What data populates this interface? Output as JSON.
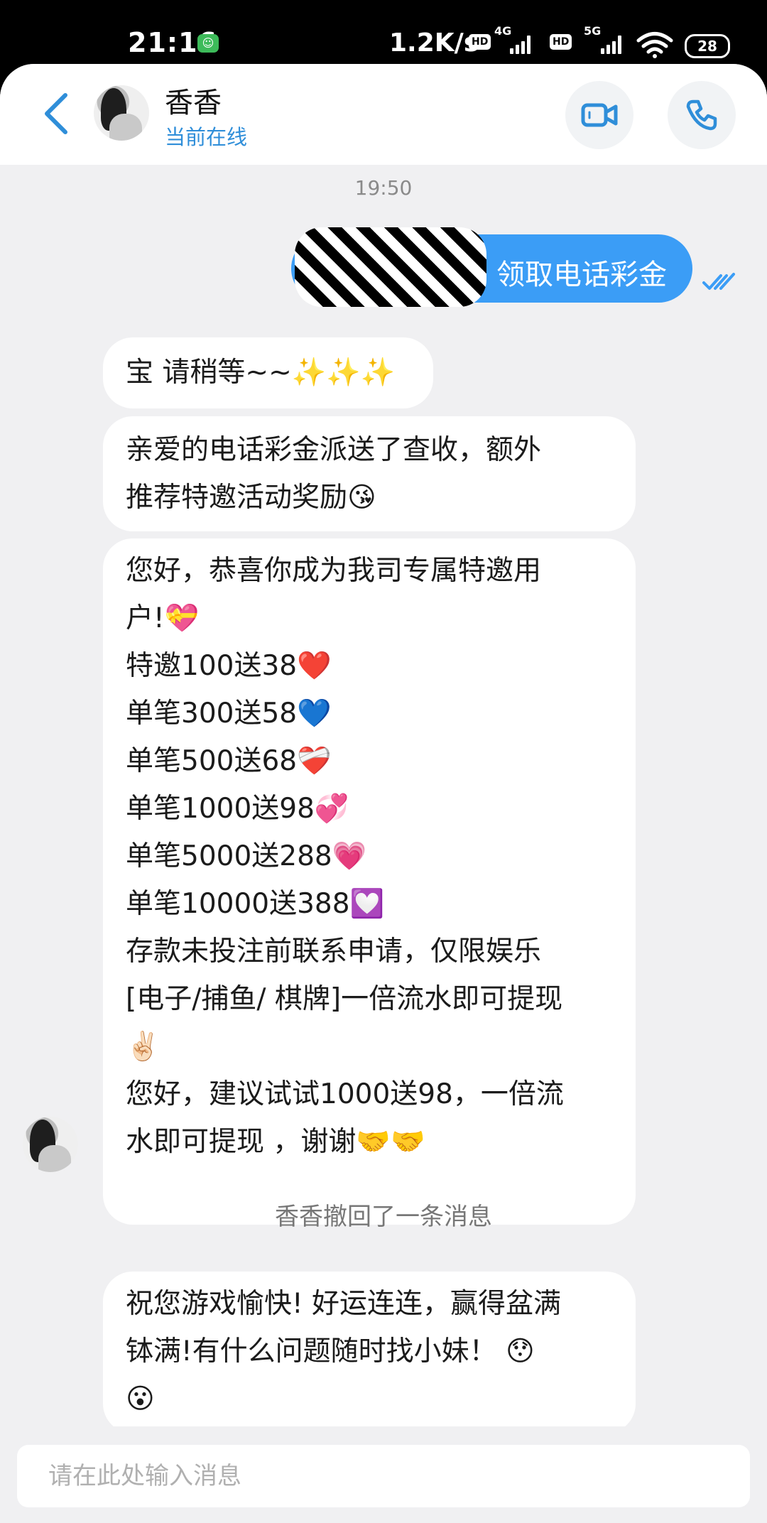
{
  "status_bar": {
    "time": "21:16",
    "net_speed": "1.2K/s",
    "hd1": "HD",
    "net1": "4G",
    "hd2": "HD",
    "net2": "5G",
    "battery": "28"
  },
  "header": {
    "contact_name": "香香",
    "presence": "当前在线"
  },
  "chat": {
    "timestamp": "19:50",
    "outgoing": {
      "text_visible": "领取电话彩金"
    },
    "messages": [
      {
        "lines": [
          "宝 请稍等~~✨✨✨"
        ]
      },
      {
        "lines": [
          "亲爱的电话彩金派送了查收，额外",
          "推荐特邀活动奖励😘"
        ]
      },
      {
        "lines": [
          "您好，恭喜你成为我司专属特邀用",
          "户!💝",
          "特邀100送38❤️",
          "单笔300送58💙",
          "单笔500送68❤️‍🩹",
          "单笔1000送98💞",
          "单笔5000送288💗",
          "单笔10000送388💟",
          "存款未投注前联系申请，仅限娱乐",
          "[电子/捕鱼/ 棋牌]一倍流水即可提现",
          "✌🏻",
          "您好，建议试试1000送98，一倍流",
          "水即可提现 ，谢谢🤝🤝"
        ]
      },
      {
        "lines": [
          "祝您游戏愉快! 好运连连，赢得盆满",
          "钵满!有什么问题随时找小妹！ 😯",
          "😮"
        ]
      }
    ],
    "system_note": "香香撤回了一条消息"
  },
  "input": {
    "placeholder": "请在此处输入消息"
  },
  "icons": {
    "back": "chevron-left-icon",
    "video": "video-camera-icon",
    "phone": "phone-icon",
    "read": "double-check-icon"
  },
  "colors": {
    "accent": "#2f8ed9",
    "outgoing_bubble": "#3b9df6",
    "background": "#f0f0f2"
  }
}
